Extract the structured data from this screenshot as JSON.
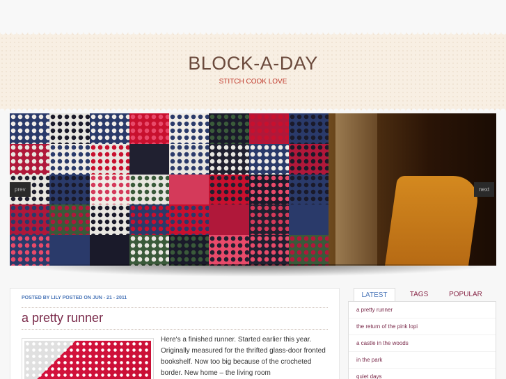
{
  "header": {
    "title": "BLOCK-A-DAY",
    "tagline": "STITCH COOK LOVE"
  },
  "slider": {
    "prev_label": "prev",
    "next_label": "next"
  },
  "post": {
    "meta": {
      "posted_by_label": "POSTED BY",
      "author": "LILY",
      "posted_on_label": "POSTED ON",
      "date": "JUN - 21 - 2011"
    },
    "title": "a pretty runner",
    "excerpt": "Here's a finished runner.  Started earlier this year. Originally measured for the thrifted glass-door fronted bookshelf.  Now too big because of the crocheted border.  New home – the living room"
  },
  "sidebar": {
    "tabs": [
      {
        "label": "LATEST",
        "active": true
      },
      {
        "label": "TAGS",
        "active": false
      },
      {
        "label": "POPULAR",
        "active": false
      }
    ],
    "latest": [
      "a pretty runner",
      "the return of the pink lopi",
      "a castle in the woods",
      "in the park",
      "quiet days"
    ]
  },
  "colors": {
    "title": "#6b4a3c",
    "tagline": "#c0392b",
    "meta": "#4a76b8",
    "link": "#7a2a4a",
    "header_bg": "#f8efe3"
  },
  "icons": {
    "prev": "prev-arrow",
    "next": "next-arrow"
  }
}
